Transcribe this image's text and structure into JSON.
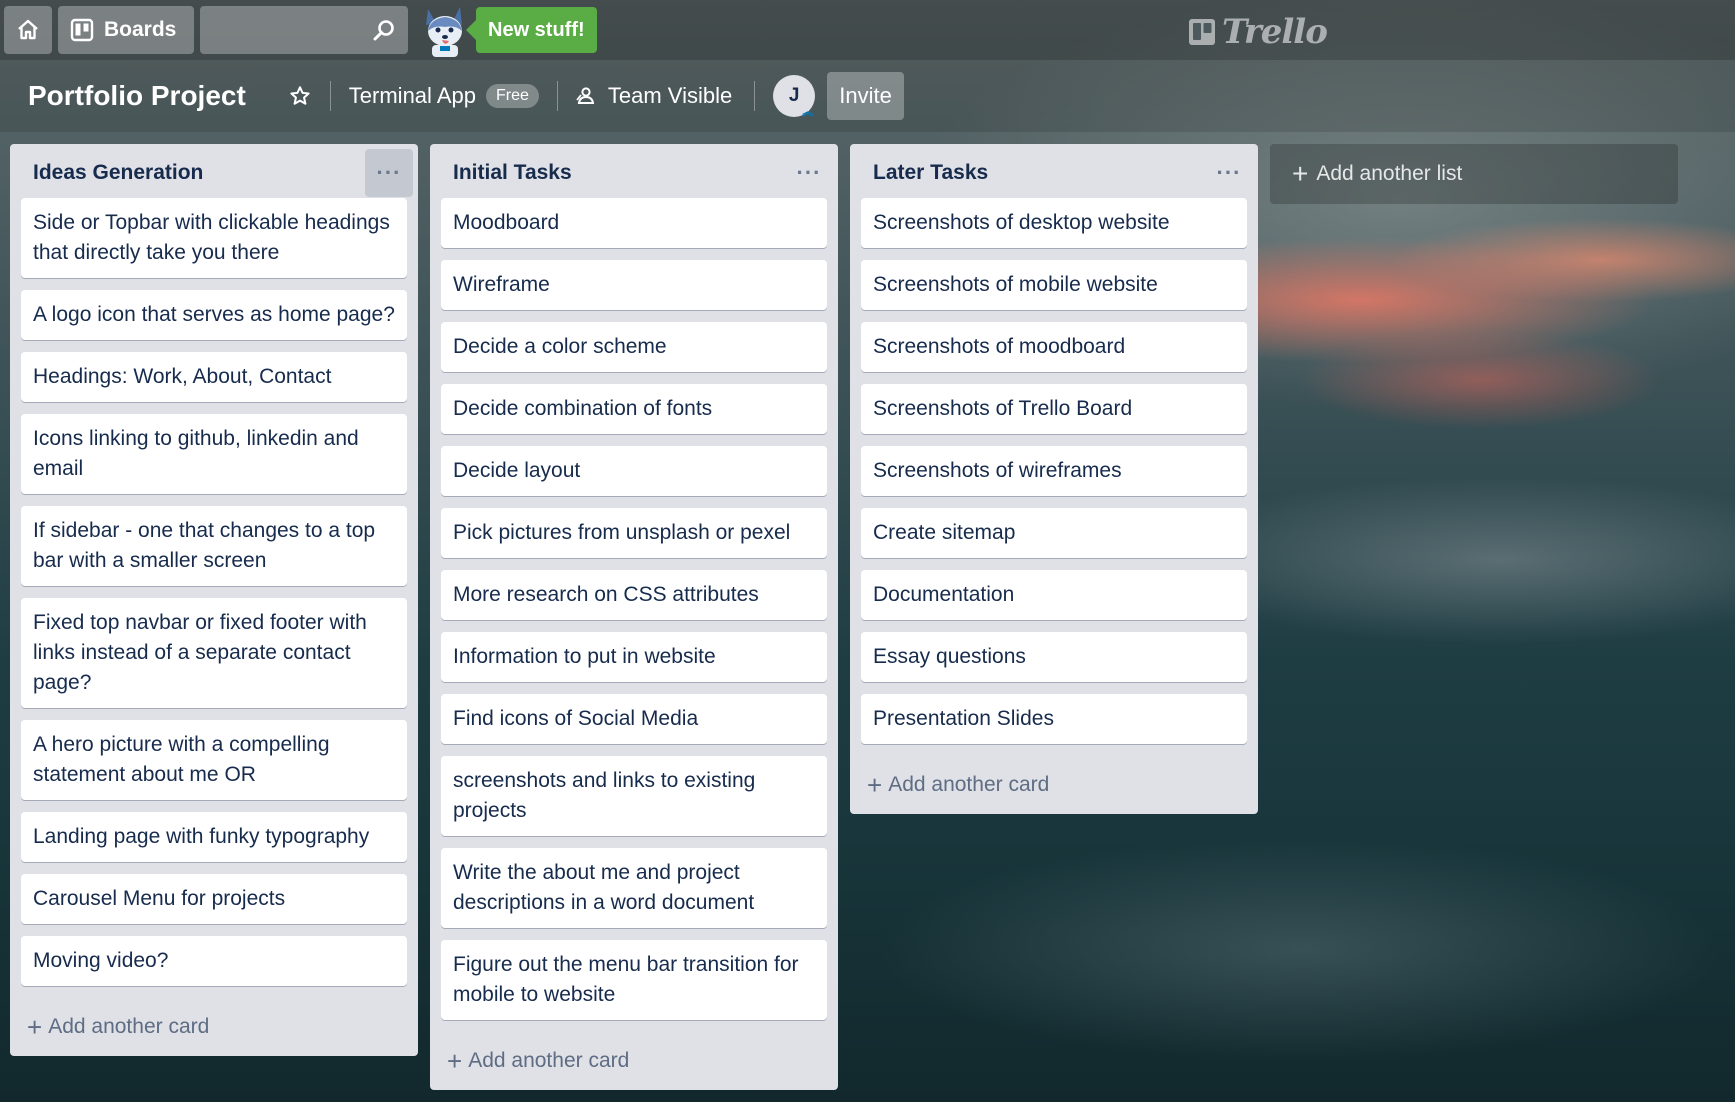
{
  "header": {
    "boards_label": "Boards",
    "search_placeholder": "",
    "new_stuff_label": "New stuff!",
    "logo_text": "Trello"
  },
  "board": {
    "title": "Portfolio Project",
    "team": "Terminal App",
    "team_badge": "Free",
    "visibility": "Team Visible",
    "avatar_initial": "J",
    "invite_label": "Invite"
  },
  "lists": [
    {
      "title": "Ideas Generation",
      "menu": "···",
      "cards": [
        "Side or Topbar with clickable headings that directly take you there",
        "A logo icon that serves as home page?",
        "Headings: Work, About, Contact",
        "Icons linking to github, linkedin and email",
        "If sidebar - one that changes to a top bar with a smaller screen",
        "Fixed top navbar or fixed footer with links instead of a separate contact page?",
        "A hero picture with a compelling statement about me OR",
        "Landing page with funky typography",
        "Carousel Menu for projects",
        "Moving video?"
      ],
      "add_card_label": "Add another card"
    },
    {
      "title": "Initial Tasks",
      "menu": "···",
      "cards": [
        "Moodboard",
        "Wireframe",
        "Decide a color scheme",
        "Decide combination of fonts",
        "Decide layout",
        "Pick pictures from unsplash or pexel",
        "More research on CSS attributes",
        "Information to put in website",
        "Find icons of Social Media",
        "screenshots and links to existing projects",
        "Write the about me and project descriptions in a word document",
        "Figure out the menu bar transition for mobile to website"
      ],
      "add_card_label": "Add another card"
    },
    {
      "title": "Later Tasks",
      "menu": "···",
      "cards": [
        "Screenshots of desktop website",
        "Screenshots of mobile website",
        "Screenshots of moodboard",
        "Screenshots of Trello Board",
        "Screenshots of wireframes",
        "Create sitemap",
        "Documentation",
        "Essay questions",
        "Presentation Slides"
      ],
      "add_card_label": "Add another card"
    }
  ],
  "add_list_label": "Add another list",
  "colors": {
    "green_accent": "#5aac44",
    "list_bg": "#dfe1e6",
    "card_text": "#172b4d"
  }
}
